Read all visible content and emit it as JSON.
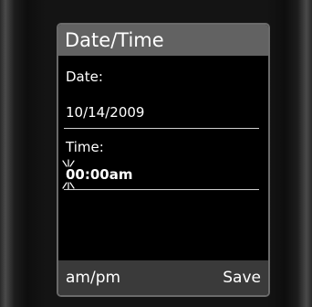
{
  "screen": {
    "title": "Date/Time"
  },
  "form": {
    "date_label": "Date:",
    "date_value": "10/14/2009",
    "time_label": "Time:",
    "time_value": "00:00am"
  },
  "softkeys": {
    "left_label": "am/pm",
    "right_label": "Save"
  },
  "colors": {
    "title_bar": "#626262",
    "screen_bg": "#000000",
    "softkey_bar": "#3a3a3a",
    "text": "#ffffff"
  },
  "icons": {
    "cursor": "blinking-cursor-icon"
  }
}
